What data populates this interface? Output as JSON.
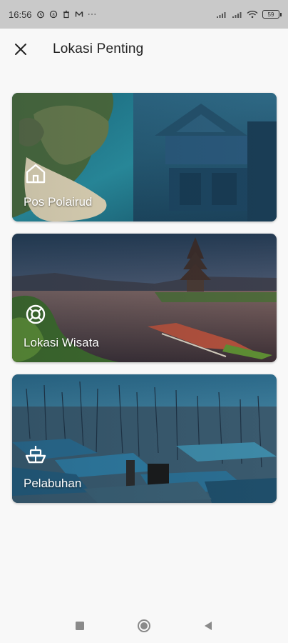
{
  "status_bar": {
    "time": "16:56",
    "battery": "59"
  },
  "header": {
    "title": "Lokasi Penting"
  },
  "cards": [
    {
      "label": "Pos Polairud",
      "icon": "home-icon"
    },
    {
      "label": "Lokasi Wisata",
      "icon": "lifebuoy-icon"
    },
    {
      "label": "Pelabuhan",
      "icon": "ship-icon"
    }
  ],
  "colors": {
    "background": "#f8f8f8",
    "status_bar": "#c9c9c9",
    "card_text": "#ffffff"
  }
}
